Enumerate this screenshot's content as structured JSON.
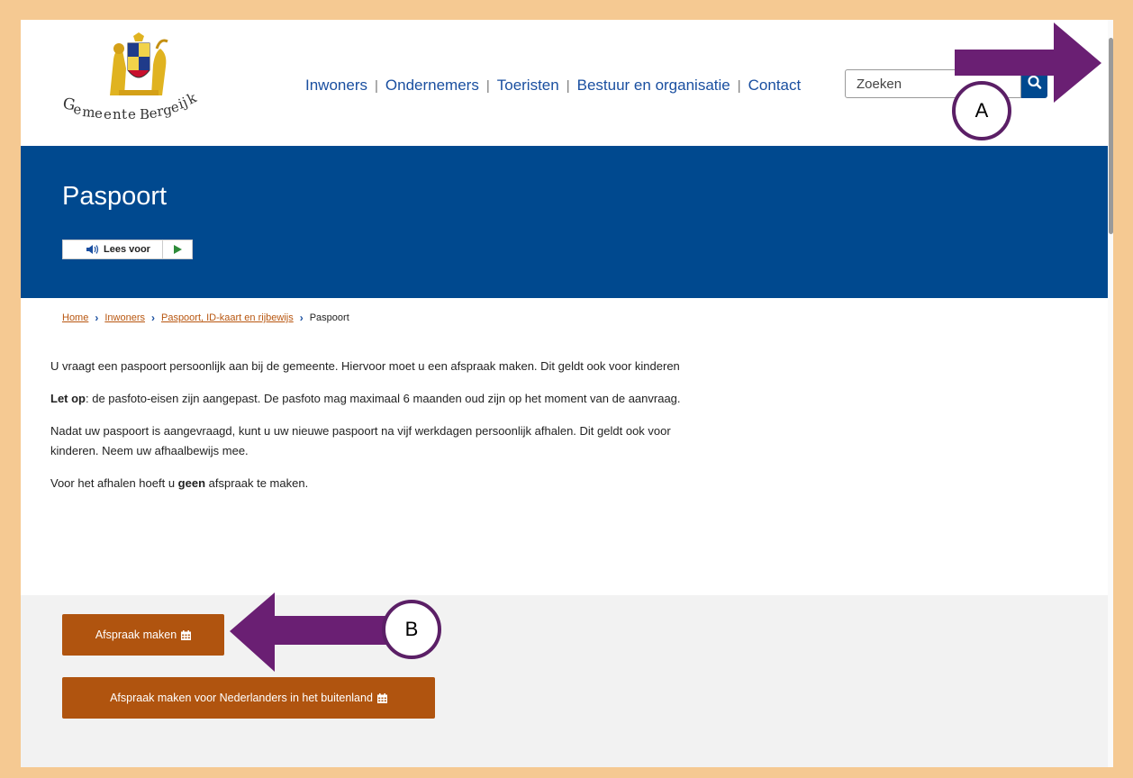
{
  "brand": {
    "name": "Gemeente Bergeijk",
    "logo_text_part1": "Gemeente",
    "logo_text_part2": "Bergeijk"
  },
  "nav": {
    "items": [
      "Inwoners",
      "Ondernemers",
      "Toeristen",
      "Bestuur en organisatie",
      "Contact"
    ]
  },
  "search": {
    "placeholder": "Zoeken",
    "icon": "search-icon"
  },
  "hero": {
    "title": "Paspoort",
    "read_aloud_label": "Lees voor",
    "read_aloud_icon": "speaker-icon",
    "play_icon": "play-icon"
  },
  "breadcrumb": {
    "items": [
      "Home",
      "Inwoners",
      "Paspoort, ID-kaart en rijbewijs"
    ],
    "current": "Paspoort"
  },
  "content": {
    "p1": "U vraagt een paspoort persoonlijk aan bij de gemeente. Hiervoor moet u een afspraak maken. Dit geldt ook voor kinderen",
    "p2_bold": "Let op",
    "p2_rest": ": de pasfoto-eisen zijn aangepast. De pasfoto mag maximaal 6 maanden oud zijn op het moment van de aanvraag.",
    "p3": "Nadat uw paspoort is aangevraagd, kunt u uw nieuwe paspoort na vijf werkdagen persoonlijk afhalen. Dit geldt ook voor kinderen. Neem uw afhaalbewijs mee.",
    "p4_start": "Voor het afhalen hoeft u ",
    "p4_bold": "geen",
    "p4_end": " afspraak te maken."
  },
  "actions": {
    "appointment_label": "Afspraak maken",
    "abroad_label": "Afspraak maken voor Nederlanders in het buitenland",
    "icon": "calendar-icon"
  },
  "annotations": {
    "a_label": "A",
    "b_label": "B",
    "arrow_color": "#6a1f73",
    "circle_color": "#5b1f66"
  },
  "colors": {
    "brand_blue": "#00498f",
    "button_orange": "#b0540f",
    "link_orange": "#b8560f",
    "nav_blue": "#1a4fa0",
    "frame_border": "#f5c992"
  }
}
